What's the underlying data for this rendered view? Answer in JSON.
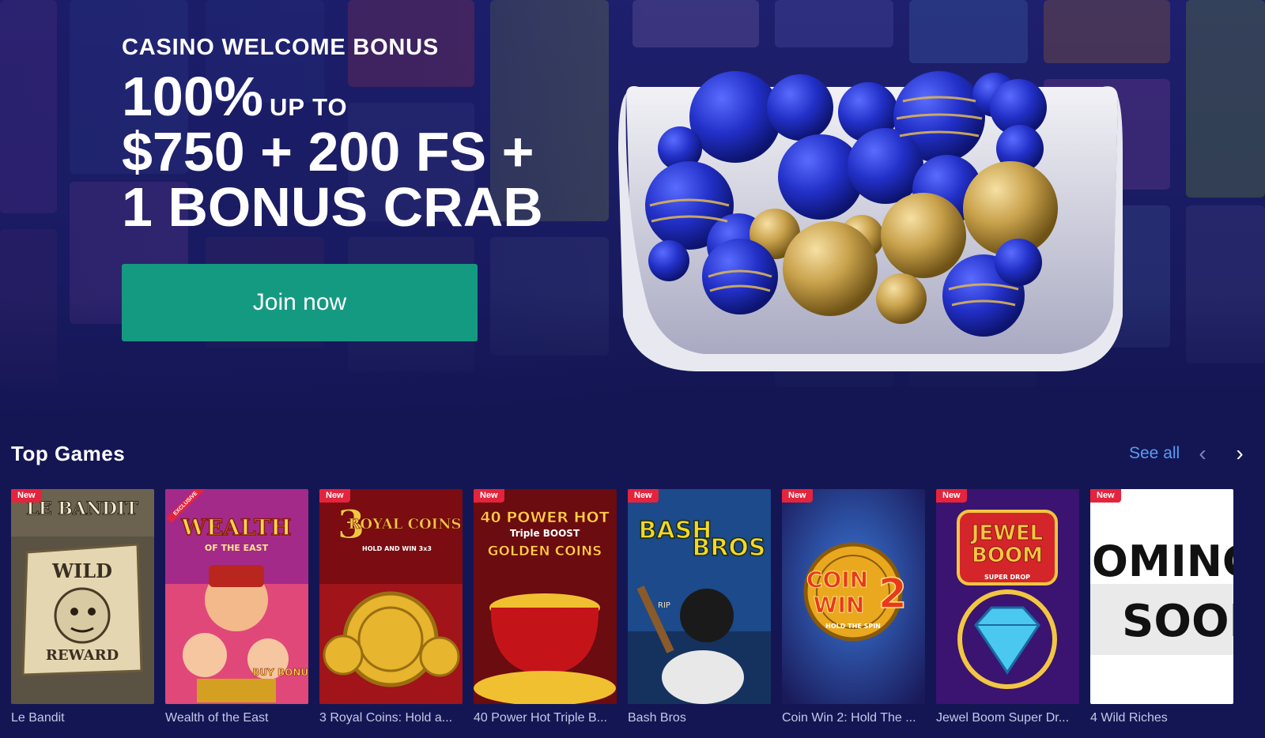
{
  "hero": {
    "kicker": "CASINO WELCOME BONUS",
    "line1_big": "100%",
    "line1_small": "UP TO",
    "line2": "$750 + 200 FS +",
    "line3": "1 BONUS CRAB",
    "cta_label": "Join now"
  },
  "top_games": {
    "title": "Top Games",
    "see_all_label": "See all",
    "prev_icon": "chevron-left-icon",
    "next_icon": "chevron-right-icon",
    "badge_label": "New",
    "exclusive_label": "EXCLUSIVE",
    "games": [
      {
        "name": "Le Bandit",
        "badge": "New",
        "art_text_1": "LE BANDIT",
        "art_text_2": "WILD",
        "art_text_3": "REWARD"
      },
      {
        "name": "Wealth of the East",
        "badge": "EXCLUSIVE",
        "art_text_1": "WEALTH",
        "art_text_2": "OF THE EAST",
        "art_text_3": "BUY BONUS"
      },
      {
        "name": "3 Royal Coins: Hold a...",
        "badge": "New",
        "art_text_1": "3",
        "art_text_2": "ROYAL COINS",
        "art_text_3": "HOLD AND WIN 3x3"
      },
      {
        "name": "40 Power Hot Triple B...",
        "badge": "New",
        "art_text_1": "40 POWER HOT",
        "art_text_2": "Triple BOOST",
        "art_text_3": "GOLDEN COINS"
      },
      {
        "name": "Bash Bros",
        "badge": "New",
        "art_text_1": "BASH",
        "art_text_2": "BROS",
        "art_text_3": "RIP"
      },
      {
        "name": "Coin Win 2: Hold The ...",
        "badge": "New",
        "art_text_1": "COIN",
        "art_text_2": "WIN",
        "art_text_3": "HOLD THE SPIN"
      },
      {
        "name": "Jewel Boom Super Dr...",
        "badge": "New",
        "art_text_1": "JEWEL",
        "art_text_2": "BOOM",
        "art_text_3": "SUPER DROP"
      },
      {
        "name": "4 Wild Riches",
        "badge": "New",
        "art_text_1": "OMING",
        "art_text_2": "SOON",
        "art_text_3": ""
      }
    ]
  },
  "colors": {
    "background": "#141654",
    "cta": "#159a82",
    "link": "#5b9cf2",
    "badge": "#e4243c"
  }
}
